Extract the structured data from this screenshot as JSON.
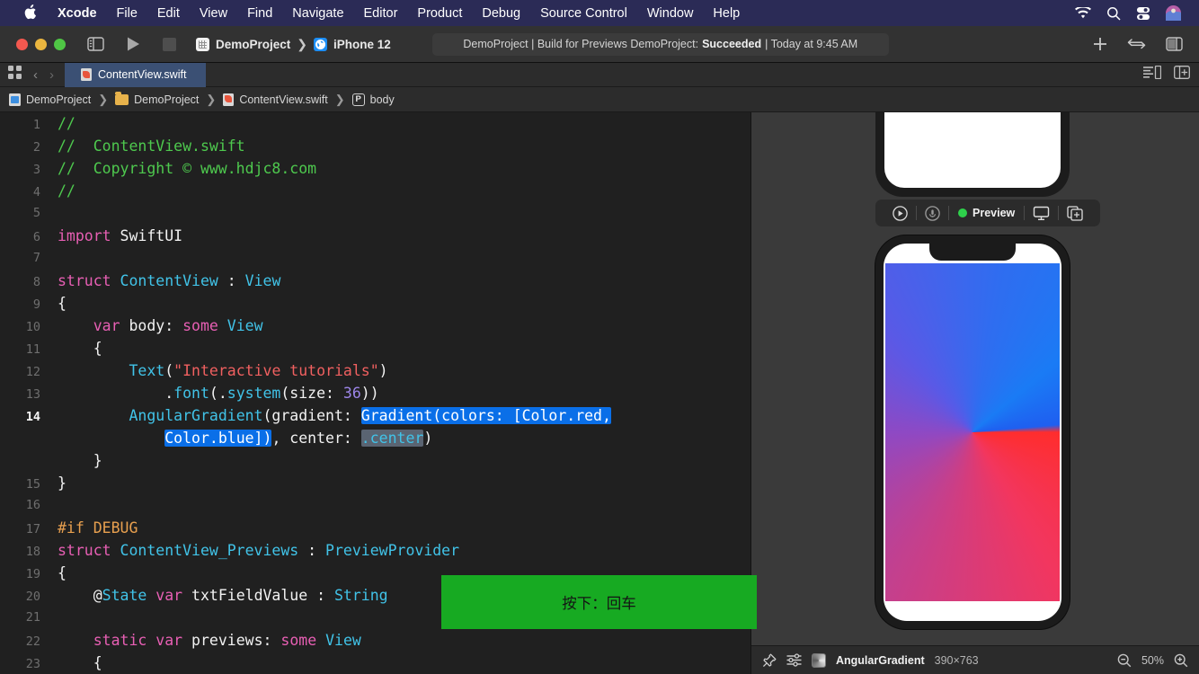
{
  "menubar": {
    "apple_glyph": "",
    "items": [
      {
        "label": "Xcode",
        "bold": true
      },
      {
        "label": "File",
        "bold": false
      },
      {
        "label": "Edit",
        "bold": false
      },
      {
        "label": "View",
        "bold": false
      },
      {
        "label": "Find",
        "bold": false
      },
      {
        "label": "Navigate",
        "bold": false
      },
      {
        "label": "Editor",
        "bold": false
      },
      {
        "label": "Product",
        "bold": false
      },
      {
        "label": "Debug",
        "bold": false
      },
      {
        "label": "Source Control",
        "bold": false
      },
      {
        "label": "Window",
        "bold": false
      },
      {
        "label": "Help",
        "bold": false
      }
    ],
    "right_icons": [
      "wifi-icon",
      "spotlight-search-icon",
      "control-center-icon",
      "user-avatar-icon"
    ],
    "background": "#2b2b56"
  },
  "toolbar": {
    "traffic_lights": [
      "close",
      "minimize",
      "zoom"
    ],
    "navigator_toggle": "sidebar-toggle-icon",
    "run_button": "run-play-icon",
    "stop_button": "stop-square-icon",
    "scheme_name": "DemoProject",
    "scheme_sep": "❯",
    "destination": "iPhone 12",
    "status": {
      "prefix": "DemoProject | Build for Previews DemoProject:",
      "result": "Succeeded",
      "suffix": "| Today at 9:45 AM"
    },
    "right_icons": [
      "add-icon",
      "library-swap-icon",
      "inspector-toggle-icon"
    ],
    "add_label": "+"
  },
  "tabbar": {
    "grid_icon": "tab-grid-icon",
    "back_arrow": "‹",
    "forward_arrow": "›",
    "active_tab": "ContentView.swift",
    "right_icons": [
      "minimap-toggle-icon",
      "assistant-editor-icon"
    ]
  },
  "breadcrumb": {
    "items": [
      {
        "label": "DemoProject",
        "icon": "xcodeproj-icon"
      },
      {
        "label": "DemoProject",
        "icon": "folder-icon"
      },
      {
        "label": "ContentView.swift",
        "icon": "swift-file-icon"
      },
      {
        "label": "body",
        "icon": "property-p-icon"
      }
    ],
    "separator": "❯",
    "p_badge": "P"
  },
  "editor": {
    "current_line": 14,
    "lines": [
      {
        "n": "1",
        "tokens": [
          {
            "t": "//",
            "c": "cm"
          }
        ]
      },
      {
        "n": "2",
        "tokens": [
          {
            "t": "//  ContentView.swift",
            "c": "cm"
          }
        ]
      },
      {
        "n": "3",
        "tokens": [
          {
            "t": "//  Copyright © www.hdjc8.com",
            "c": "cm"
          }
        ]
      },
      {
        "n": "4",
        "tokens": [
          {
            "t": "//",
            "c": "cm"
          }
        ]
      },
      {
        "n": "5",
        "tokens": []
      },
      {
        "n": "6",
        "tokens": [
          {
            "t": "import",
            "c": "kw"
          },
          {
            "t": " SwiftUI",
            "c": "pl"
          }
        ]
      },
      {
        "n": "7",
        "tokens": []
      },
      {
        "n": "8",
        "tokens": [
          {
            "t": "struct",
            "c": "kw"
          },
          {
            "t": " ",
            "c": "pl"
          },
          {
            "t": "ContentView",
            "c": "ty"
          },
          {
            "t": " : ",
            "c": "pl"
          },
          {
            "t": "View",
            "c": "ty"
          }
        ]
      },
      {
        "n": "9",
        "tokens": [
          {
            "t": "{",
            "c": "pl"
          }
        ]
      },
      {
        "n": "10",
        "tokens": [
          {
            "t": "    ",
            "c": "pl"
          },
          {
            "t": "var",
            "c": "kw"
          },
          {
            "t": " body: ",
            "c": "pl"
          },
          {
            "t": "some",
            "c": "kw"
          },
          {
            "t": " ",
            "c": "pl"
          },
          {
            "t": "View",
            "c": "ty"
          }
        ]
      },
      {
        "n": "11",
        "tokens": [
          {
            "t": "    {",
            "c": "pl"
          }
        ]
      },
      {
        "n": "12",
        "tokens": [
          {
            "t": "        ",
            "c": "pl"
          },
          {
            "t": "Text",
            "c": "ty"
          },
          {
            "t": "(",
            "c": "pl"
          },
          {
            "t": "\"Interactive tutorials\"",
            "c": "str"
          },
          {
            "t": ")",
            "c": "pl"
          }
        ]
      },
      {
        "n": "13",
        "tokens": [
          {
            "t": "            .",
            "c": "pl"
          },
          {
            "t": "font",
            "c": "ty"
          },
          {
            "t": "(.",
            "c": "pl"
          },
          {
            "t": "system",
            "c": "ty"
          },
          {
            "t": "(size: ",
            "c": "pl"
          },
          {
            "t": "36",
            "c": "num"
          },
          {
            "t": "))",
            "c": "pl"
          }
        ]
      },
      {
        "n": "14",
        "tokens": [
          {
            "t": "        ",
            "c": "pl"
          },
          {
            "t": "AngularGradient",
            "c": "ty"
          },
          {
            "t": "(gradient: ",
            "c": "pl"
          },
          {
            "t": "Gradient(colors: [Color.red,",
            "c": "selb"
          }
        ]
      },
      {
        "n": "",
        "tokens": [
          {
            "t": "            ",
            "c": "pl"
          },
          {
            "t": "Color.blue])",
            "c": "selb"
          },
          {
            "t": ", center: ",
            "c": "pl"
          },
          {
            "t": ".center",
            "c": "selg ty"
          },
          {
            "t": ")",
            "c": "pl"
          }
        ]
      },
      {
        "n": "",
        "tokens": [
          {
            "t": "    }",
            "c": "pl"
          }
        ]
      },
      {
        "n": "15",
        "tokens": [
          {
            "t": "}",
            "c": "pl"
          }
        ]
      },
      {
        "n": "16",
        "tokens": []
      },
      {
        "n": "17",
        "tokens": [
          {
            "t": "#if",
            "c": "pre"
          },
          {
            "t": " ",
            "c": "pl"
          },
          {
            "t": "DEBUG",
            "c": "pre"
          }
        ]
      },
      {
        "n": "18",
        "tokens": [
          {
            "t": "struct",
            "c": "kw"
          },
          {
            "t": " ",
            "c": "pl"
          },
          {
            "t": "ContentView_Previews",
            "c": "ty"
          },
          {
            "t": " : ",
            "c": "pl"
          },
          {
            "t": "PreviewProvider",
            "c": "ty"
          }
        ]
      },
      {
        "n": "19",
        "tokens": [
          {
            "t": "{",
            "c": "pl"
          }
        ]
      },
      {
        "n": "20",
        "tokens": [
          {
            "t": "    @",
            "c": "pl"
          },
          {
            "t": "State",
            "c": "ty"
          },
          {
            "t": " ",
            "c": "pl"
          },
          {
            "t": "var",
            "c": "kw"
          },
          {
            "t": " txtFieldValue : ",
            "c": "pl"
          },
          {
            "t": "String",
            "c": "ty"
          }
        ]
      },
      {
        "n": "21",
        "tokens": []
      },
      {
        "n": "22",
        "tokens": [
          {
            "t": "    ",
            "c": "pl"
          },
          {
            "t": "static",
            "c": "kw"
          },
          {
            "t": " ",
            "c": "pl"
          },
          {
            "t": "var",
            "c": "kw"
          },
          {
            "t": " previews: ",
            "c": "pl"
          },
          {
            "t": "some",
            "c": "kw"
          },
          {
            "t": " ",
            "c": "pl"
          },
          {
            "t": "View",
            "c": "ty"
          }
        ]
      },
      {
        "n": "23",
        "tokens": [
          {
            "t": "    {",
            "c": "pl"
          }
        ]
      }
    ],
    "selection_color": "#0a6fe8",
    "background": "#202020"
  },
  "tooltip": {
    "text": "按下：回车",
    "background": "#17aa22"
  },
  "preview": {
    "toolbar": {
      "play_icon": "play-circle-icon",
      "record_icon": "record-circle-icon",
      "status_label": "Preview",
      "status_color": "#2ed14b",
      "device_icon": "device-settings-icon",
      "duplicate_icon": "duplicate-preview-icon"
    },
    "device_name": "AngularGradient",
    "dimensions": "390×763",
    "zoom_level": "50%",
    "statusbar_icons": [
      "pin-icon",
      "adjust-sliders-icon",
      "zoom-out-icon",
      "zoom-in-icon"
    ],
    "gradient_colors": [
      "#ff2d2d",
      "#1a7bf5"
    ]
  }
}
